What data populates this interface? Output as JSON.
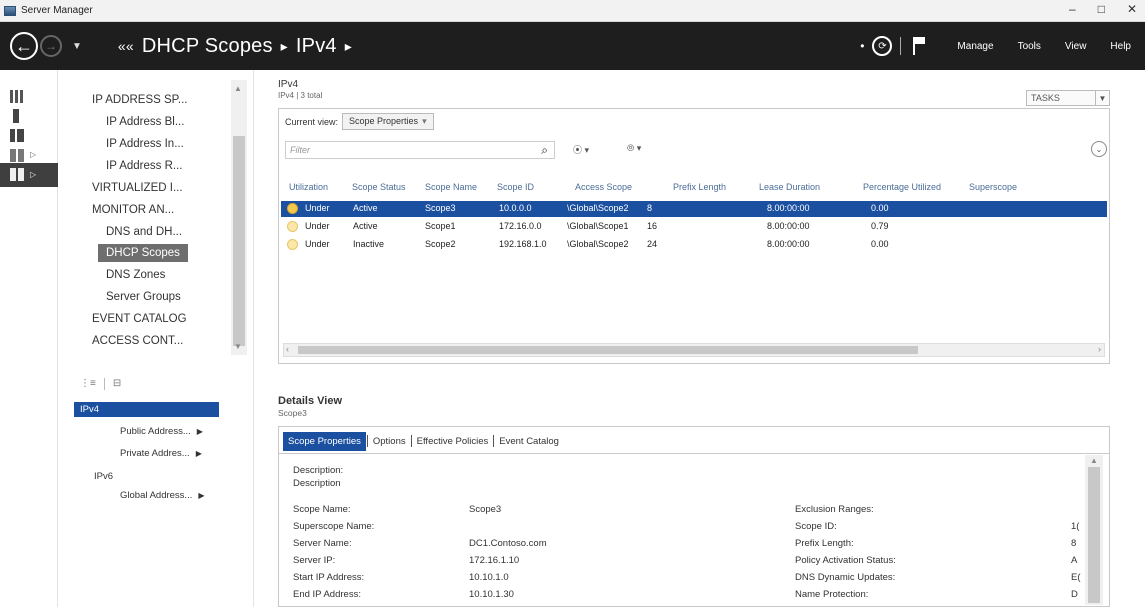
{
  "window": {
    "title": "Server Manager",
    "minimize": "–",
    "maximize": "□",
    "close": "✕"
  },
  "nav": {
    "breadcrumb": [
      "DHCP Scopes",
      "IPv4"
    ],
    "menu": [
      "Manage",
      "Tools",
      "View",
      "Help"
    ]
  },
  "tree": {
    "items": [
      "IP ADDRESS SP...",
      "IP Address Bl...",
      "IP Address In...",
      "IP Address R...",
      "VIRTUALIZED I...",
      "MONITOR AN...",
      "DNS and DH...",
      "DHCP Scopes",
      "DNS Zones",
      "Server Groups",
      "EVENT CATALOG",
      "ACCESS CONT..."
    ],
    "sub_items": [
      "IPv4",
      "Public Address...",
      "Private Addres...",
      "IPv6",
      "Global Address..."
    ]
  },
  "list": {
    "title": "IPv4",
    "subtitle": "IPv4 | 3 total",
    "tasks_label": "TASKS",
    "current_view_label": "Current view:",
    "current_view_value": "Scope Properties",
    "filter_placeholder": "Filter",
    "columns": [
      "Utilization",
      "Scope Status",
      "Scope Name",
      "Scope ID",
      "Access Scope",
      "Prefix Length",
      "Lease Duration",
      "Percentage Utilized",
      "Superscope"
    ],
    "rows": [
      [
        "Under",
        "Active",
        "Scope3",
        "10.0.0.0",
        "\\Global\\Scope2",
        "8",
        "8.00:00:00",
        "0.00"
      ],
      [
        "Under",
        "Active",
        "Scope1",
        "172.16.0.0",
        "\\Global\\Scope1",
        "16",
        "8.00:00:00",
        "0.79"
      ],
      [
        "Under",
        "Inactive",
        "Scope2",
        "192.168.1.0",
        "\\Global\\Scope2",
        "24",
        "8.00:00:00",
        "0.00"
      ]
    ]
  },
  "details": {
    "title": "Details View",
    "subtitle": "Scope3",
    "tabs": [
      "Scope Properties",
      "Options",
      "Effective Policies",
      "Event Catalog"
    ],
    "description_label": "Description:",
    "description_value": "Description",
    "left_props": [
      [
        "Scope Name:",
        "Scope3"
      ],
      [
        "Superscope Name:",
        ""
      ],
      [
        "Server Name:",
        "DC1.Contoso.com"
      ],
      [
        "Server IP:",
        "172.16.1.10"
      ],
      [
        "Start IP Address:",
        "10.10.1.0"
      ],
      [
        "End IP Address:",
        "10.10.1.30"
      ]
    ],
    "right_props": [
      [
        "Exclusion Ranges:",
        ""
      ],
      [
        "Scope ID:",
        "1("
      ],
      [
        "Prefix Length:",
        "8"
      ],
      [
        "Policy Activation Status:",
        "A"
      ],
      [
        "DNS Dynamic Updates:",
        "E("
      ],
      [
        "Name Protection:",
        "D"
      ]
    ]
  }
}
